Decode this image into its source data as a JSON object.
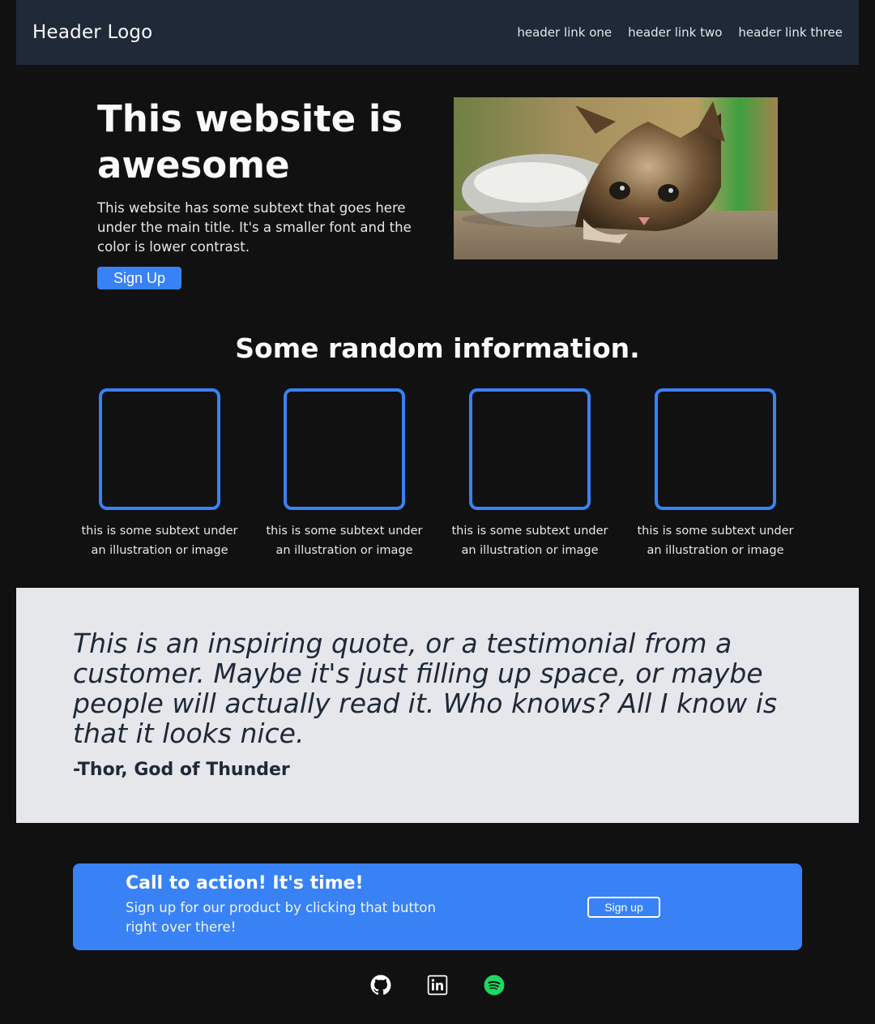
{
  "header": {
    "logo": "Header Logo",
    "links": [
      "header link one",
      "header link two",
      "header link three"
    ]
  },
  "hero": {
    "title": "This website is awesome",
    "subtext": "This website has some subtext that goes here under the main title. It's a smaller font and the color is lower contrast.",
    "button_label": "Sign Up",
    "image": "kitten-photo"
  },
  "info": {
    "title": "Some random information.",
    "cards": [
      {
        "text": "this is some subtext under an illustration or image"
      },
      {
        "text": "this is some subtext under an illustration or image"
      },
      {
        "text": "this is some subtext under an illustration or image"
      },
      {
        "text": "this is some subtext under an illustration or image"
      }
    ]
  },
  "quote": {
    "text": "This is an inspiring quote, or a testimonial from a customer. Maybe it's just filling up space, or maybe people will actually read it. Who knows? All I know is that it looks nice.",
    "author": "-Thor, God of Thunder"
  },
  "cta": {
    "title": "Call to action! It's time!",
    "subtext": "Sign up for our product by clicking that button right over there!",
    "button_label": "Sign up"
  },
  "footer": {
    "icons": [
      "github-icon",
      "linkedin-icon",
      "spotify-icon"
    ]
  },
  "colors": {
    "page_bg": "#111111",
    "header_bg": "#1f2937",
    "accent": "#3882f6",
    "quote_bg": "#e5e7eb",
    "spotify": "#1ed760"
  }
}
